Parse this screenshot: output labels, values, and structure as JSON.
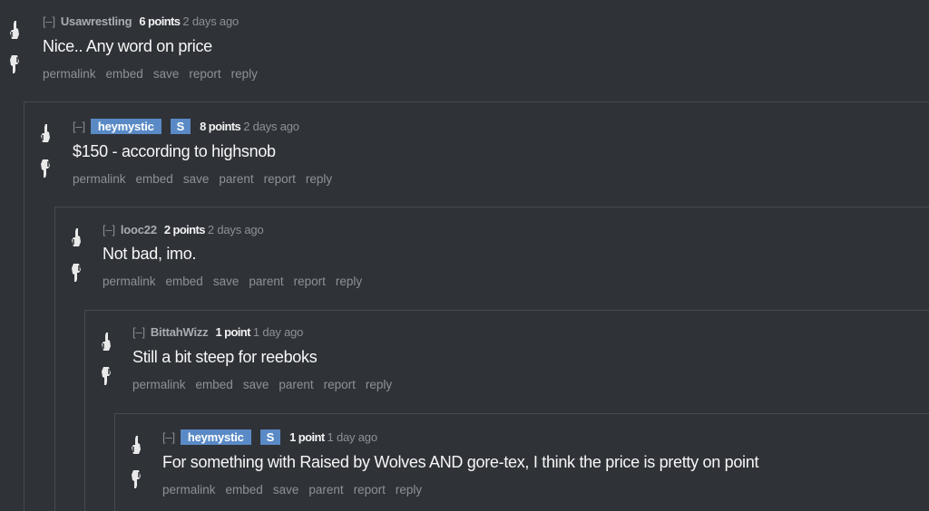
{
  "comments": [
    {
      "collapse": "[–]",
      "author": "Usawrestling",
      "is_op": false,
      "flair": "",
      "score": "6 points",
      "time": "2 days ago",
      "body": "Nice.. Any word on price",
      "actions": [
        "permalink",
        "embed",
        "save",
        "report",
        "reply"
      ]
    },
    {
      "collapse": "[–]",
      "author": "heymystic",
      "is_op": true,
      "flair": "S",
      "score": "8 points",
      "time": "2 days ago",
      "body": "$150 - according to highsnob",
      "actions": [
        "permalink",
        "embed",
        "save",
        "parent",
        "report",
        "reply"
      ]
    },
    {
      "collapse": "[–]",
      "author": "looc22",
      "is_op": false,
      "flair": "",
      "score": "2 points",
      "time": "2 days ago",
      "body": "Not bad, imo.",
      "actions": [
        "permalink",
        "embed",
        "save",
        "parent",
        "report",
        "reply"
      ]
    },
    {
      "collapse": "[–]",
      "author": "BittahWizz",
      "is_op": false,
      "flair": "",
      "score": "1 point",
      "time": "1 day ago",
      "body": "Still a bit steep for reeboks",
      "actions": [
        "permalink",
        "embed",
        "save",
        "parent",
        "report",
        "reply"
      ]
    },
    {
      "collapse": "[–]",
      "author": "heymystic",
      "is_op": true,
      "flair": "S",
      "score": "1 point",
      "time": "1 day ago",
      "body": "For something with Raised by Wolves AND gore-tex, I think the price is pretty on point",
      "actions": [
        "permalink",
        "embed",
        "save",
        "parent",
        "report",
        "reply"
      ]
    }
  ],
  "colors": {
    "background": "#2f3237",
    "op_highlight": "#5a8ac6",
    "nest_border": "#474b52"
  }
}
